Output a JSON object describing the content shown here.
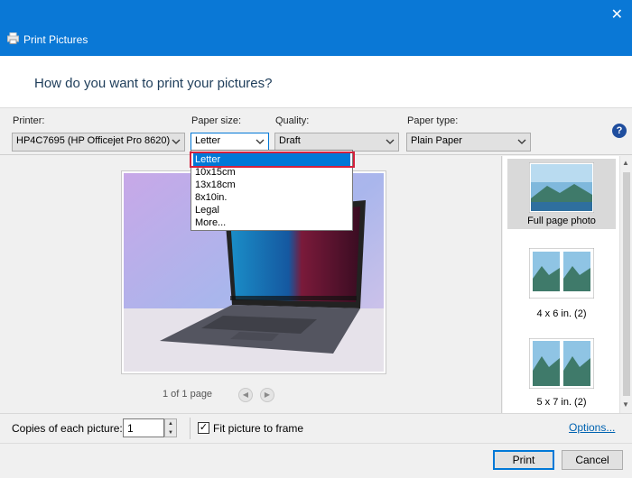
{
  "window": {
    "title": "Print Pictures",
    "close_glyph": "✕"
  },
  "header": {
    "question": "How do you want to print your pictures?"
  },
  "printer": {
    "label": "Printer:",
    "value": "HP4C7695 (HP Officejet Pro 8620)"
  },
  "paper_size": {
    "label": "Paper size:",
    "value": "Letter",
    "options": [
      "Letter",
      "10x15cm",
      "13x18cm",
      "8x10in.",
      "Legal",
      "More..."
    ],
    "highlighted": 0
  },
  "quality": {
    "label": "Quality:",
    "value": "Draft"
  },
  "paper_type": {
    "label": "Paper type:",
    "value": "Plain Paper"
  },
  "help": {
    "glyph": "?"
  },
  "preview": {
    "page_info": "1 of 1 page",
    "prev_glyph": "◀",
    "next_glyph": "▶"
  },
  "layouts": [
    {
      "label": "Full page photo",
      "selected": true
    },
    {
      "label": "4 x 6 in. (2)",
      "selected": false
    },
    {
      "label": "5 x 7 in. (2)",
      "selected": false
    }
  ],
  "footer": {
    "copies_label": "Copies of each picture:",
    "copies_value": "1",
    "fit_label": "Fit picture to frame",
    "fit_checked": true,
    "check_glyph": "✓",
    "options_link": "Options...",
    "print_button": "Print",
    "cancel_button": "Cancel"
  },
  "colors": {
    "titlebar": "#0a78d6",
    "highlight": "#0078d7",
    "annotation_red": "#d4203c",
    "link": "#0063b1"
  }
}
